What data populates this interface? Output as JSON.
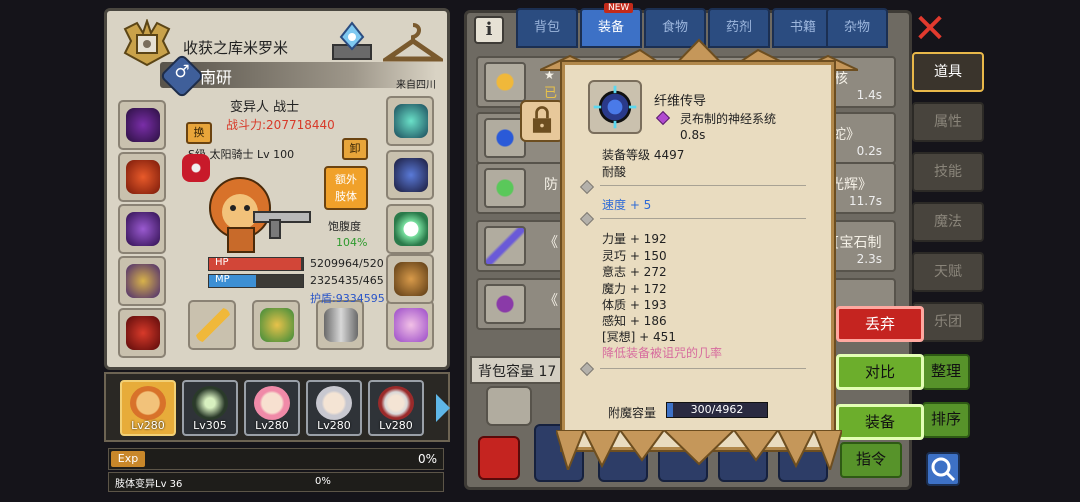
{
  "colors": {
    "accent": "#3d71c6",
    "danger": "#c52420",
    "confirm": "#6cae2c",
    "power": "#d83a2a",
    "buff": "#2f6bd6",
    "debuff": "#d76c9e",
    "satiety": "#2e9a2e",
    "hp": "#d24638",
    "mp": "#3c8fd4"
  },
  "character": {
    "guild_title": "收获之库米罗米",
    "name": "南研",
    "origin": "来自四川",
    "class": "变异人 战士",
    "power": "战斗力:207718440",
    "title": "S级 太阳骑士 Lv 100",
    "swap_label": "换",
    "unequip_label": "卸",
    "extra_limb_label_1": "额外",
    "extra_limb_label_2": "肢体",
    "satiety_label": "饱腹度",
    "satiety_value": "104%",
    "hp_label": "HP",
    "hp_value": "5209964/520",
    "hp_fraction": 0.98,
    "mp_label": "MP",
    "mp_value": "2325435/465",
    "mp_fraction": 0.5,
    "shield": "护盾:9334595"
  },
  "party": [
    {
      "level": "Lv280",
      "icon": "lion-hero-portrait",
      "selected": true
    },
    {
      "level": "Lv305",
      "icon": "winged-spirit-portrait",
      "selected": false
    },
    {
      "level": "Lv280",
      "icon": "pink-haired-girl-portrait",
      "selected": false
    },
    {
      "level": "Lv280",
      "icon": "silver-haired-portrait",
      "selected": false
    },
    {
      "level": "Lv280",
      "icon": "white-haired-red-eyes-portrait",
      "selected": false
    }
  ],
  "exp": {
    "badge": "Exp",
    "percent": "0%",
    "fraction": 0.0
  },
  "limb_skill": {
    "label": "肢体变异Lv 36",
    "percent": "0%"
  },
  "tabs": [
    {
      "label": "背包"
    },
    {
      "label": "装备"
    },
    {
      "label": "食物"
    },
    {
      "label": "药剂"
    },
    {
      "label": "书籍"
    },
    {
      "label": "杂物"
    }
  ],
  "new_badge": "NEW",
  "inventory": [
    {
      "name": "★",
      "time": "1.4s",
      "name2": "已"
    },
    {
      "name": "",
      "time": "0.2s",
      "name2": "蛇》"
    },
    {
      "name": "防",
      "time": "11.7s",
      "name2": "光辉》"
    },
    {
      "name": "《",
      "time": "2.3s",
      "name2": "[宝石制"
    },
    {
      "name": "《",
      "time": "",
      "name2": ""
    }
  ],
  "inventory_extra": {
    "row1_suffix": "核"
  },
  "capacity_label": "背包容量 17",
  "side_tabs": [
    {
      "label": "道具",
      "active": true
    },
    {
      "label": "属性",
      "active": false
    },
    {
      "label": "技能",
      "active": false
    },
    {
      "label": "魔法",
      "active": false
    },
    {
      "label": "天赋",
      "active": false
    },
    {
      "label": "乐团",
      "active": false
    }
  ],
  "actions": {
    "discard": "丢弃",
    "compare": "对比",
    "equip": "装备",
    "sort": "整理",
    "order": "排序",
    "command": "指令"
  },
  "popup": {
    "item_name": "纤维传导",
    "material": "灵布制的神经系统",
    "time": "0.8s",
    "level": "装备等级 4497",
    "trait": "耐酸",
    "speed": "速度 + 5",
    "stats": [
      "力量 + 192",
      "灵巧 + 150",
      "意志 + 272",
      "魔力 + 172",
      "体质 + 193",
      "感知 + 186",
      "[冥想] + 451"
    ],
    "curse_note": "降低装备被诅咒的几率",
    "enchant_label": "附魔容量",
    "enchant_value": "300/4962",
    "enchant_fraction": 0.06
  }
}
